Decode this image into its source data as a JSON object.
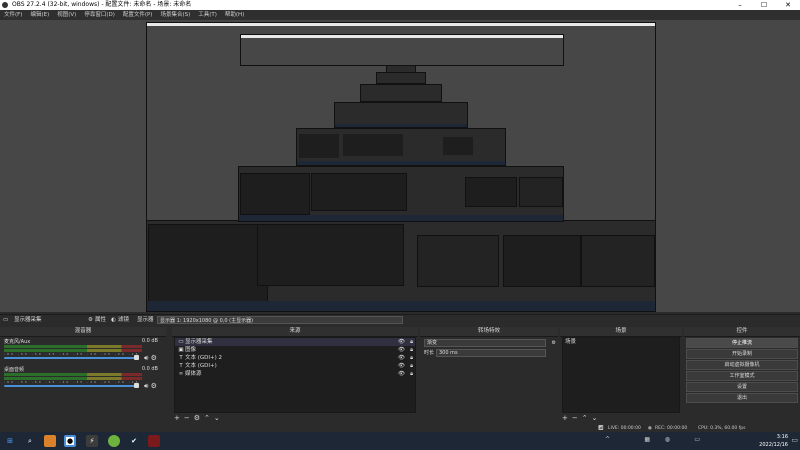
{
  "window": {
    "title": "OBS 27.2.4 (32-bit, windows) - 配置文件: 未命名 - 场景: 未命名",
    "minimize": "–",
    "maximize": "☐",
    "close": "✕"
  },
  "menu": [
    "文件(F)",
    "编辑(E)",
    "视图(V)",
    "停靠窗口(D)",
    "配置文件(P)",
    "场景集合(S)",
    "工具(T)",
    "帮助(H)"
  ],
  "source_bar": {
    "source_label": "显示器采集",
    "properties": "属性",
    "filters": "滤镜",
    "display_label": "显示器",
    "display_value": "显示器 1: 1920x1080 @ 0,0 (主显示器)"
  },
  "audio_mixer": {
    "title": "混音器",
    "channels": [
      {
        "name": "麦克风/Aux",
        "db": "0.0 dB"
      },
      {
        "name": "桌面音频",
        "db": "0.0 dB"
      }
    ],
    "ticks": "-60 -55 -50 -45 -40 -35 -30 -25 -20 -15 -10 -5 0"
  },
  "sources": {
    "title": "来源",
    "items": [
      {
        "name": "显示器采集",
        "icon": "monitor-icon"
      },
      {
        "name": "图像",
        "icon": "image-icon"
      },
      {
        "name": "文本 (GDI+) 2",
        "icon": "text-icon"
      },
      {
        "name": "文本 (GDI+)",
        "icon": "text-icon"
      },
      {
        "name": "媒体源",
        "icon": "media-icon"
      }
    ]
  },
  "transitions": {
    "title": "转场特效",
    "type": "渐变",
    "duration_label": "时长",
    "duration": "300 ms"
  },
  "scenes": {
    "title": "场景",
    "items": [
      "场景"
    ]
  },
  "controls": {
    "title": "控件",
    "buttons": [
      "停止推流",
      "开始录制",
      "启动虚拟摄像机",
      "工作室模式",
      "设置",
      "退出"
    ]
  },
  "status": {
    "live": "LIVE: 00:00:00",
    "rec": "REC: 00:00:00",
    "cpu": "CPU: 0.3%, 60.00 fps"
  },
  "clock": {
    "time": "3:16",
    "date": "2022/12/16"
  },
  "colors": {
    "accent": "#4a90d9",
    "meter_green": "#2c6f2a",
    "taskbar": "#1d2736"
  }
}
